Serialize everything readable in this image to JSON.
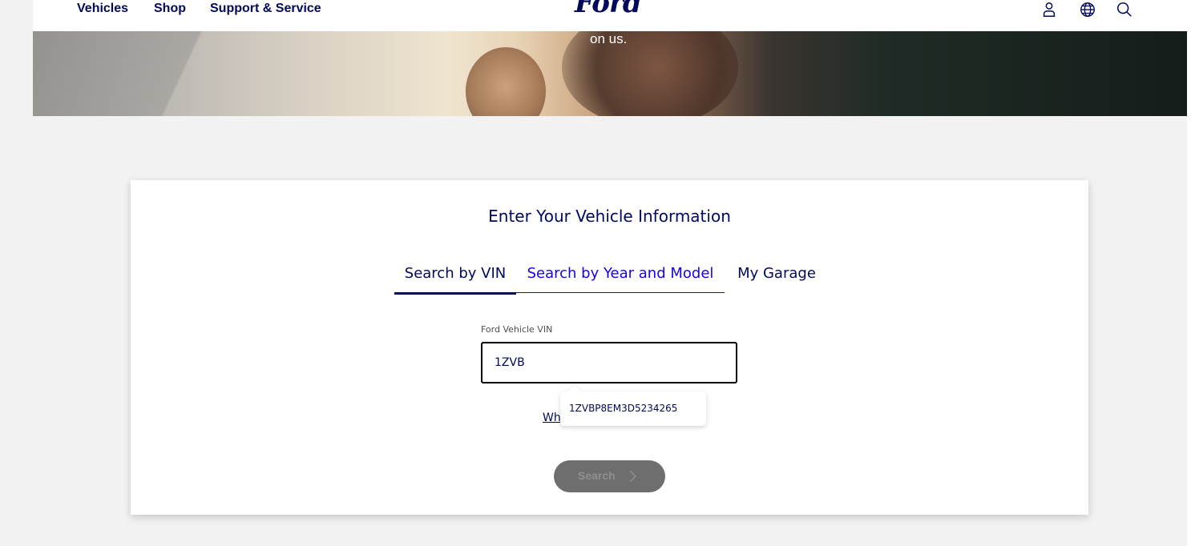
{
  "nav": {
    "links": [
      "Vehicles",
      "Shop",
      "Support & Service"
    ],
    "logo": "Ford",
    "icons": [
      "account-icon",
      "globe-icon",
      "search-icon"
    ]
  },
  "hero": {
    "caption": "on us."
  },
  "card": {
    "title": "Enter Your Vehicle Information",
    "tabs": [
      {
        "label": "Search by VIN",
        "active": true
      },
      {
        "label": "Search by Year and Model",
        "active": false
      },
      {
        "label": "My Garage",
        "active": false
      }
    ],
    "vin_label": "Ford Vehicle VIN",
    "vin_value": "1ZVB",
    "help_link_visible": "Wh",
    "suggestion": "1ZVBP8EM3D5234265",
    "search_button": "Search"
  },
  "colors": {
    "brand": "#00095b",
    "link": "#1700f4",
    "disabled_button": "#6e6e6e"
  }
}
